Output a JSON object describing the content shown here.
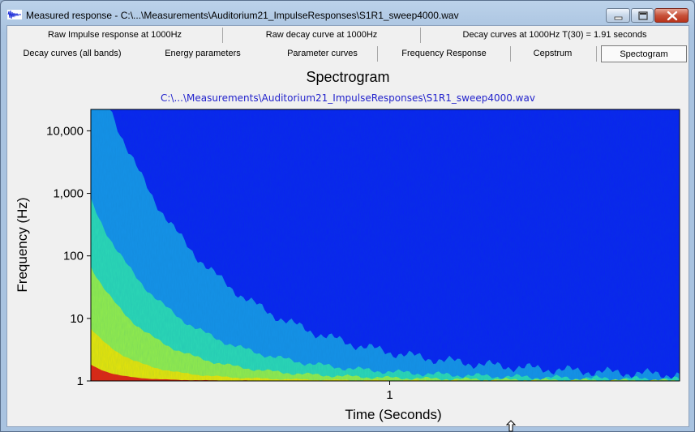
{
  "window": {
    "title": "Measured response - C:\\...\\Measurements\\Auditorium21_ImpulseResponses\\S1R1_sweep4000.wav",
    "icon": "waveform-icon",
    "controls": [
      "minimize-icon",
      "maximize-icon",
      "close-icon"
    ]
  },
  "tabs": {
    "row1": [
      "Raw Impulse response at 1000Hz",
      "Raw decay curve at 1000Hz",
      "Decay curves at 1000Hz T(30) = 1.91 seconds"
    ],
    "row2": [
      "Decay curves (all bands)",
      "Energy parameters",
      "Parameter curves",
      "Frequency Response",
      "Cepstrum",
      "Spectogram"
    ],
    "selected": "Spectogram"
  },
  "chart_data": {
    "type": "heatmap",
    "title": "Spectrogram",
    "subtitle": "C:\\...\\Measurements\\Auditorium21_ImpulseResponses\\S1R1_sweep4000.wav",
    "xlabel": "Time (Seconds)",
    "ylabel": "Frequency (Hz)",
    "x_ticks": [
      "1"
    ],
    "y_ticks": [
      "1",
      "10",
      "100",
      "1,000",
      "10,000"
    ],
    "y_scale": "log",
    "xlim": [
      0,
      1.97
    ],
    "ylim": [
      1,
      22000
    ],
    "colormap": [
      "#0a24f0",
      "#19a6e6",
      "#2fe0b0",
      "#9ef040",
      "#f2e400",
      "#e41010"
    ],
    "background_color": "#0a24f0"
  }
}
